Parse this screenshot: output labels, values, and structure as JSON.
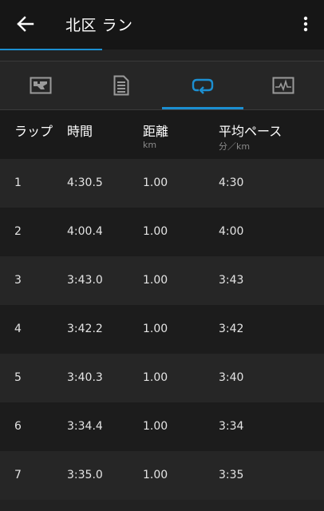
{
  "appbar": {
    "title": "北区 ラン",
    "back_icon": "arrow-left-icon",
    "menu_icon": "more-vert-icon"
  },
  "accent_color": "#1c8fd1",
  "tabs": [
    {
      "icon": "map-icon",
      "active": false
    },
    {
      "icon": "document-icon",
      "active": false
    },
    {
      "icon": "laps-loop-icon",
      "active": true
    },
    {
      "icon": "chart-icon",
      "active": false
    }
  ],
  "columns": [
    {
      "label": "ラップ",
      "unit": ""
    },
    {
      "label": "時間",
      "unit": ""
    },
    {
      "label": "距離",
      "unit": "km"
    },
    {
      "label": "平均ペース",
      "unit": "分／km"
    }
  ],
  "laps": [
    {
      "lap": "1",
      "time": "4:30.5",
      "distance": "1.00",
      "pace": "4:30"
    },
    {
      "lap": "2",
      "time": "4:00.4",
      "distance": "1.00",
      "pace": "4:00"
    },
    {
      "lap": "3",
      "time": "3:43.0",
      "distance": "1.00",
      "pace": "3:43"
    },
    {
      "lap": "4",
      "time": "3:42.2",
      "distance": "1.00",
      "pace": "3:42"
    },
    {
      "lap": "5",
      "time": "3:40.3",
      "distance": "1.00",
      "pace": "3:40"
    },
    {
      "lap": "6",
      "time": "3:34.4",
      "distance": "1.00",
      "pace": "3:34"
    },
    {
      "lap": "7",
      "time": "3:35.0",
      "distance": "1.00",
      "pace": "3:35"
    }
  ]
}
